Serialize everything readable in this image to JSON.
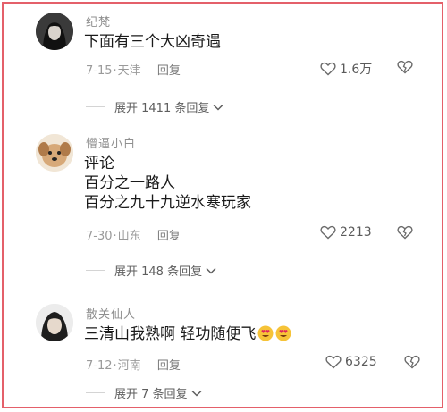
{
  "comments": [
    {
      "username": "纪梵",
      "lines": [
        "下面有三个大凶奇遇"
      ],
      "date": "7-15",
      "location": "天津",
      "reply_label": "回复",
      "likes": "1.6万",
      "expand_label": "展开 1411 条回复"
    },
    {
      "username": "懵逼小白",
      "lines": [
        "评论",
        "百分之一路人",
        "百分之九十九逆水寒玩家"
      ],
      "date": "7-30",
      "location": "山东",
      "reply_label": "回复",
      "likes": "2213",
      "expand_label": "展开 148 条回复"
    },
    {
      "username": "散关仙人",
      "lines": [
        "三清山我熟啊 轻功随便飞"
      ],
      "date": "7-12",
      "location": "河南",
      "reply_label": "回复",
      "likes": "6325",
      "expand_label": "展开 7 条回复"
    }
  ],
  "colors": {
    "frame": "#e4606a",
    "meta": "#9a9a9a"
  }
}
